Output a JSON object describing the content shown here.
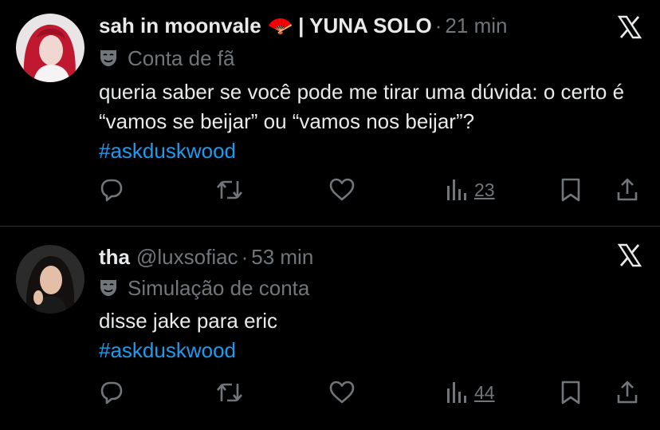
{
  "tweets": [
    {
      "display_name": "sah in moonvale",
      "emoji": "🪭",
      "name_suffix": "| YUNA SOLO",
      "handle": "",
      "separator": "·",
      "time": "21 min",
      "label": "Conta de fã",
      "text": "queria saber se você pode me tirar uma dúvida: o certo é “vamos se beijar” ou “vamos nos beijar”?",
      "hashtag": "#askduskwood",
      "views": "23"
    },
    {
      "display_name": "tha",
      "emoji": "",
      "name_suffix": "",
      "handle": "@luxsofiac",
      "separator": "·",
      "time": "53 min",
      "label": "Simulação de conta",
      "text": "disse jake para eric",
      "hashtag": "#askduskwood",
      "views": "44"
    }
  ],
  "colors": {
    "background": "#000000",
    "text": "#e7e9ea",
    "muted": "#71767b",
    "link": "#1d9bf0",
    "divider": "#2f3336"
  },
  "icons": [
    "x-logo-icon",
    "mask-icon",
    "reply-icon",
    "retweet-icon",
    "like-icon",
    "views-icon",
    "bookmark-icon",
    "share-icon"
  ]
}
